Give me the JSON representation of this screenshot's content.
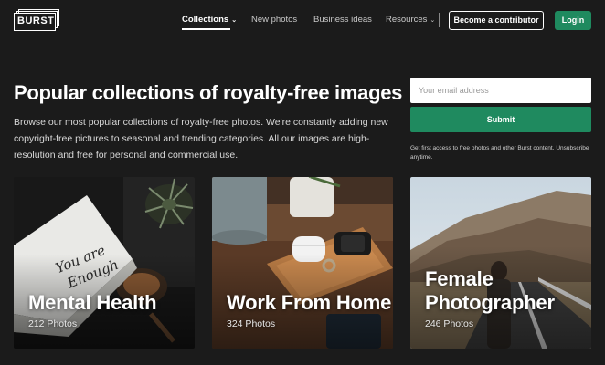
{
  "brand": {
    "logo_text": "BURST"
  },
  "nav": {
    "items": [
      {
        "label": "Collections",
        "chevron": true,
        "active": true
      },
      {
        "label": "New photos",
        "chevron": false,
        "active": false
      },
      {
        "label": "Business ideas",
        "chevron": false,
        "active": false
      },
      {
        "label": "Resources",
        "chevron": true,
        "active": false
      }
    ],
    "contributor_label": "Become a contributor",
    "login_label": "Login"
  },
  "hero": {
    "title": "Popular collections of royalty-free images",
    "description": "Browse our most popular collections of royalty-free photos. We're constantly adding new copyright-free pictures to seasonal and trending categories. All our images are high-resolution and free for personal and commercial use."
  },
  "signup": {
    "email_placeholder": "Your email address",
    "email_value": "",
    "submit_label": "Submit",
    "fine_print": "Get first access to free photos and other Burst content. Unsubscribe anytime."
  },
  "collections": [
    {
      "title": "Mental Health",
      "count": "212 Photos",
      "image_text": "You are Enough"
    },
    {
      "title": "Work From Home",
      "count": "324 Photos"
    },
    {
      "title": "Female Photographer",
      "count": "246 Photos"
    }
  ],
  "colors": {
    "background": "#1b1b1b",
    "accent": "#1f8a5f"
  }
}
